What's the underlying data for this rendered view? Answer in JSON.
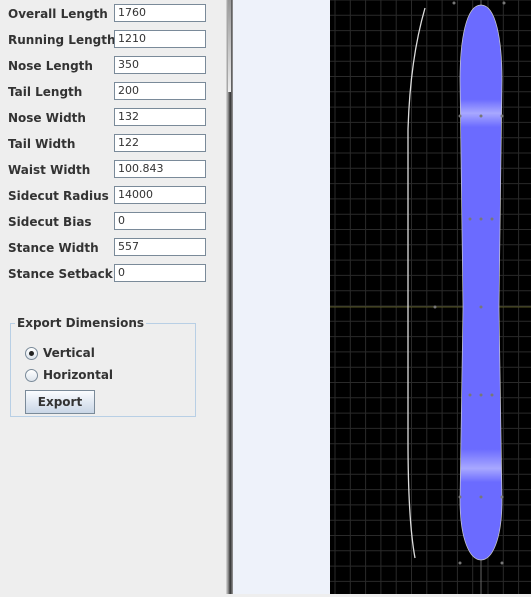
{
  "fields": [
    {
      "label": "Overall Length",
      "value": "1760"
    },
    {
      "label": "Running Length",
      "value": "1210"
    },
    {
      "label": "Nose Length",
      "value": "350"
    },
    {
      "label": "Tail Length",
      "value": "200"
    },
    {
      "label": "Nose Width",
      "value": "132"
    },
    {
      "label": "Tail Width",
      "value": "122"
    },
    {
      "label": "Waist Width",
      "value": "100.843"
    },
    {
      "label": "Sidecut Radius",
      "value": "14000"
    },
    {
      "label": "Sidecut Bias",
      "value": "0"
    },
    {
      "label": "Stance Width",
      "value": "557"
    },
    {
      "label": "Stance Setback",
      "value": "0"
    }
  ],
  "export": {
    "title": "Export Dimensions",
    "options": [
      {
        "label": "Vertical",
        "selected": true
      },
      {
        "label": "Horizontal",
        "selected": false
      }
    ],
    "button": "Export"
  },
  "colors": {
    "board": "#6b6bff",
    "canvas": "#000000",
    "grid": "#2a2a2a"
  }
}
